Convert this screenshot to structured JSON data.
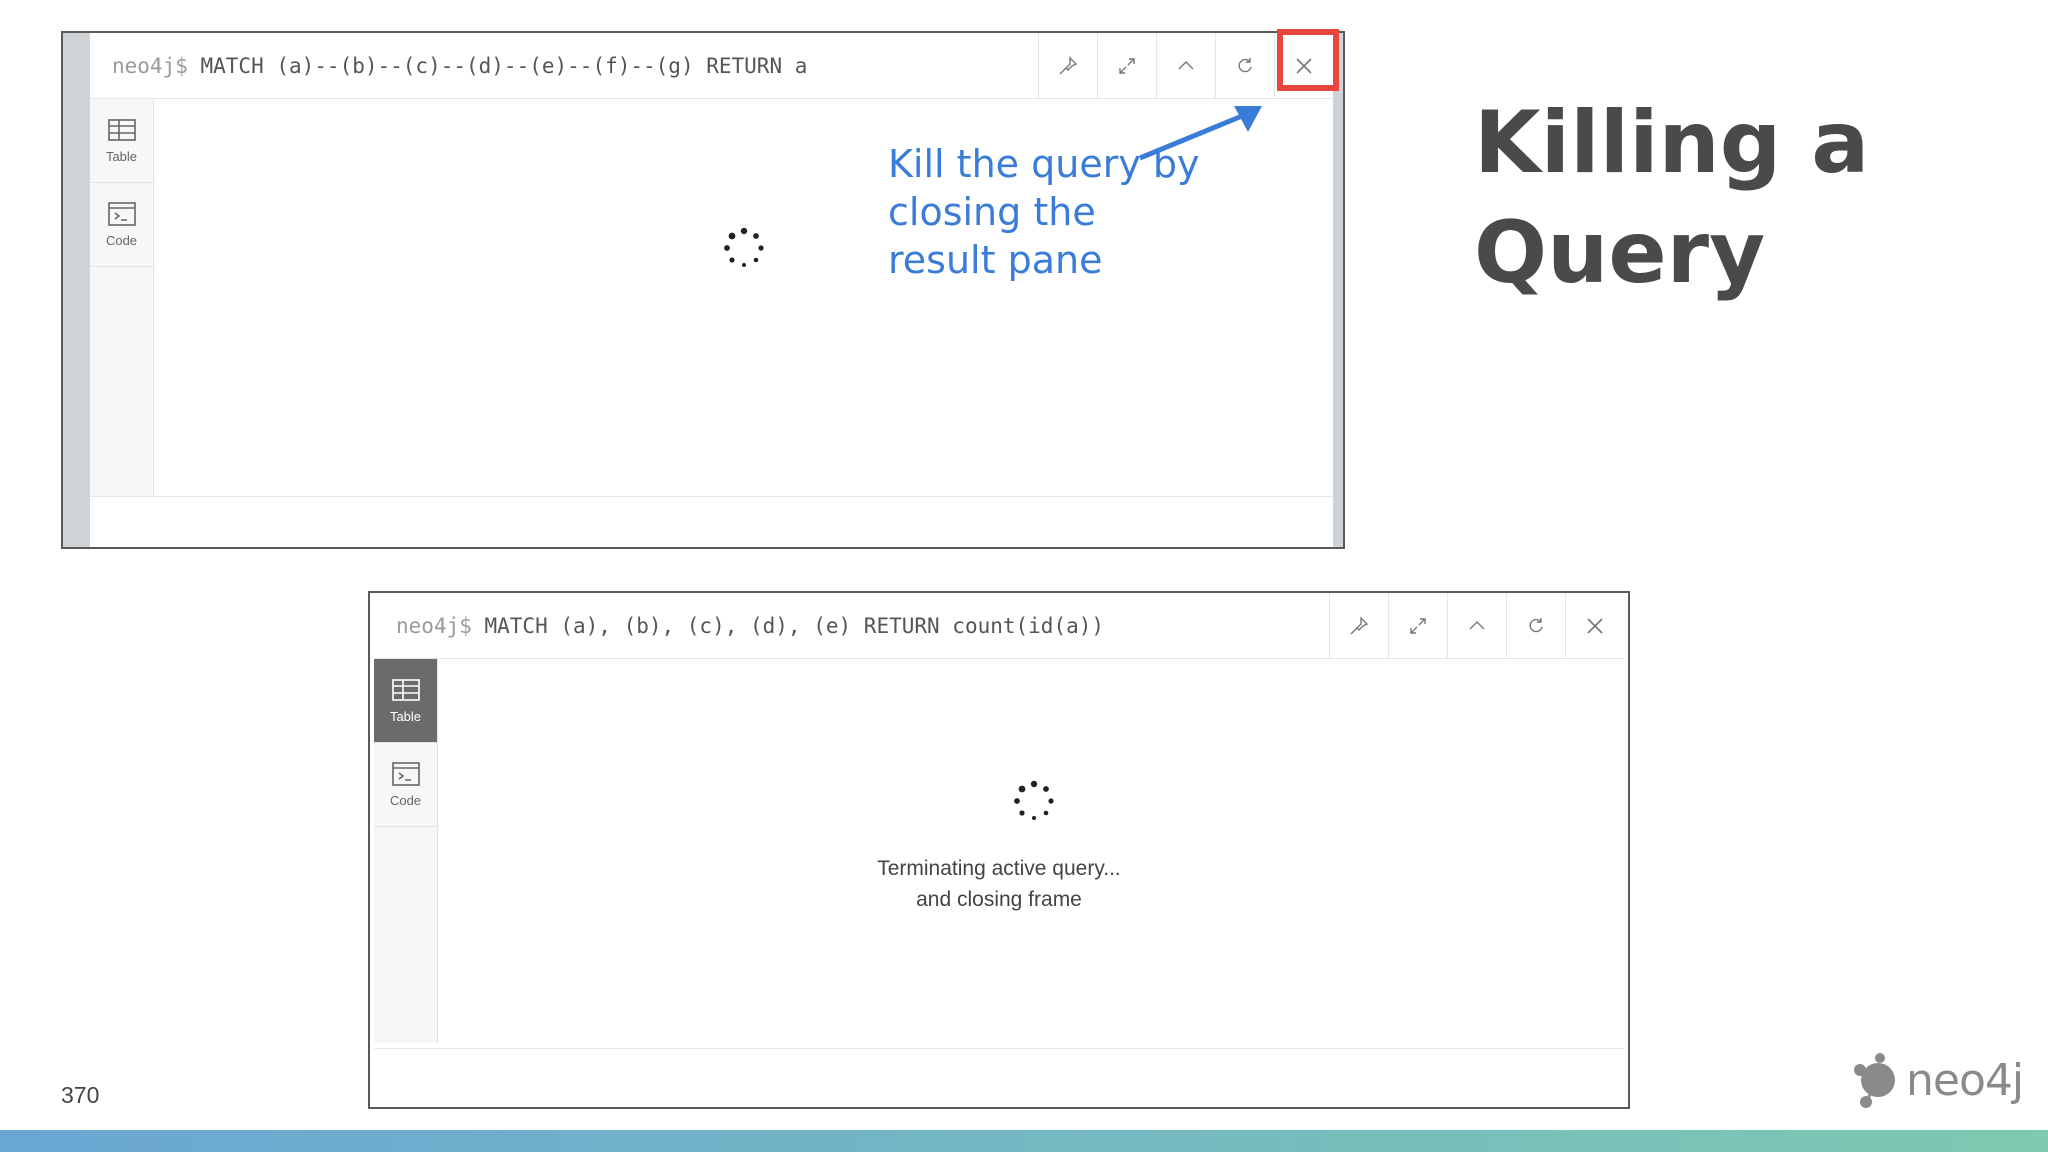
{
  "frame1": {
    "prompt": "neo4j$",
    "query": " MATCH (a)--(b)--(c)--(d)--(e)--(f)--(g) RETURN a",
    "sidebar": [
      {
        "label": "Table",
        "icon": "table-icon"
      },
      {
        "label": "Code",
        "icon": "code-icon"
      }
    ]
  },
  "frame2": {
    "prompt": "neo4j$",
    "query": " MATCH (a), (b), (c), (d), (e) RETURN count(id(a))",
    "sidebar": [
      {
        "label": "Table",
        "icon": "table-icon",
        "active": true
      },
      {
        "label": "Code",
        "icon": "code-icon"
      }
    ],
    "status_line1": "Terminating active query...",
    "status_line2": "and closing frame"
  },
  "annotation": {
    "line1": "Kill the query by",
    "line2": "closing the",
    "line3": "result pane",
    "color": "#3a7cd8"
  },
  "slide": {
    "title_line1": "Killing a",
    "title_line2": "Query",
    "page_number": "370",
    "logo_text": "neo4j",
    "highlight_color": "#e8473e"
  }
}
